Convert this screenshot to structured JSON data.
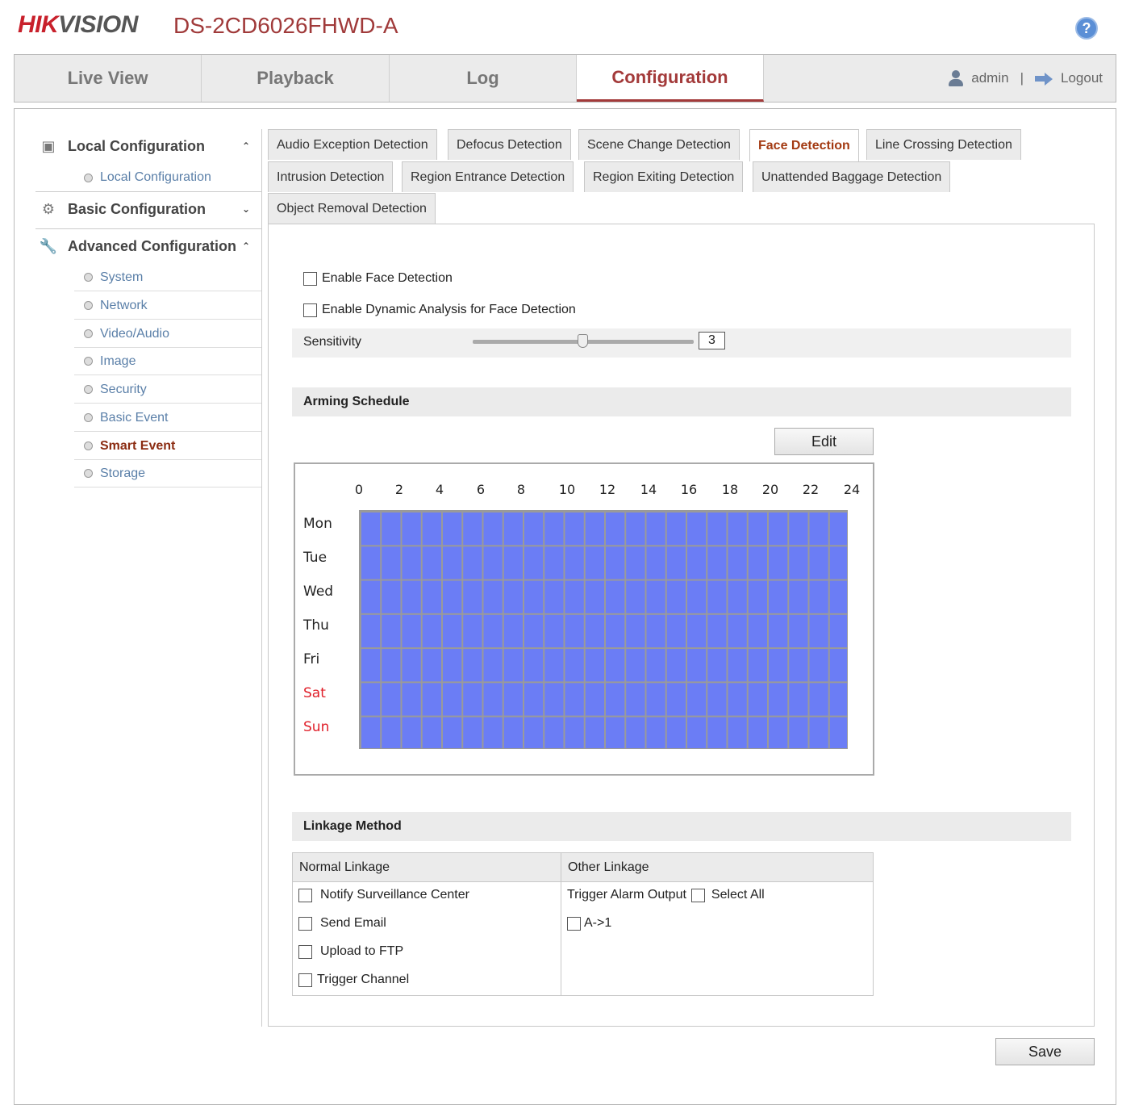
{
  "header": {
    "logo_main": "HIK",
    "logo_rest": "VISION",
    "model": "DS-2CD6026FHWD-A",
    "help_symbol": "?"
  },
  "topnav": {
    "tabs": [
      {
        "label": "Live View"
      },
      {
        "label": "Playback"
      },
      {
        "label": "Log"
      },
      {
        "label": "Configuration"
      }
    ],
    "active_tab": "Configuration",
    "user": "admin",
    "separator": "|",
    "logout": "Logout"
  },
  "sidebar": {
    "local": {
      "label": "Local Configuration",
      "chevron": "⌃",
      "items": [
        {
          "label": "Local Configuration"
        }
      ]
    },
    "basic": {
      "label": "Basic Configuration",
      "chevron": "⌄"
    },
    "advanced": {
      "label": "Advanced Configuration",
      "chevron": "⌃",
      "items": [
        {
          "label": "System"
        },
        {
          "label": "Network"
        },
        {
          "label": "Video/Audio"
        },
        {
          "label": "Image"
        },
        {
          "label": "Security"
        },
        {
          "label": "Basic Event"
        },
        {
          "label": "Smart Event"
        },
        {
          "label": "Storage"
        }
      ],
      "active_item": "Smart Event"
    }
  },
  "detection_tabs": [
    {
      "label": "Audio Exception Detection"
    },
    {
      "label": "Defocus Detection"
    },
    {
      "label": "Scene Change Detection"
    },
    {
      "label": "Face Detection"
    },
    {
      "label": "Line Crossing Detection"
    },
    {
      "label": "Intrusion Detection"
    },
    {
      "label": "Region Entrance Detection"
    },
    {
      "label": "Region Exiting Detection"
    },
    {
      "label": "Unattended Baggage Detection"
    },
    {
      "label": "Object Removal Detection"
    }
  ],
  "active_detection_tab": "Face Detection",
  "settings": {
    "enable_face_detection": {
      "label": "Enable Face Detection",
      "checked": false
    },
    "enable_dynamic_analysis": {
      "label": "Enable Dynamic Analysis for Face Detection",
      "checked": false
    },
    "sensitivity": {
      "label": "Sensitivity",
      "value": "3",
      "min": 1,
      "max": 5
    }
  },
  "arming_schedule": {
    "title": "Arming Schedule",
    "edit_label": "Edit",
    "hours": [
      "0",
      "2",
      "4",
      "6",
      "8",
      "10",
      "12",
      "14",
      "16",
      "18",
      "20",
      "22",
      "24"
    ],
    "days": [
      {
        "label": "Mon",
        "weekend": false
      },
      {
        "label": "Tue",
        "weekend": false
      },
      {
        "label": "Wed",
        "weekend": false
      },
      {
        "label": "Thu",
        "weekend": false
      },
      {
        "label": "Fri",
        "weekend": false
      },
      {
        "label": "Sat",
        "weekend": true
      },
      {
        "label": "Sun",
        "weekend": true
      }
    ],
    "armed_color": "#6b7df5",
    "weekend_color": "#e0202a",
    "coverage": "all day, every day"
  },
  "linkage": {
    "title": "Linkage Method",
    "normal_header": "Normal Linkage",
    "other_header": "Other Linkage",
    "normal_items": [
      {
        "label": "Notify Surveillance Center",
        "checked": false
      },
      {
        "label": "Send Email",
        "checked": false
      },
      {
        "label": "Upload to FTP",
        "checked": false
      },
      {
        "label": "Trigger Channel",
        "checked": false
      }
    ],
    "trigger_alarm_output": "Trigger Alarm Output",
    "select_all": "Select All",
    "outputs": [
      {
        "label": "A->1",
        "checked": false
      }
    ]
  },
  "save_label": "Save",
  "colors": {
    "brand_red": "#c8202b",
    "accent": "#a33a3a",
    "active_item": "#8b2c12",
    "link": "#5a7fa8"
  }
}
